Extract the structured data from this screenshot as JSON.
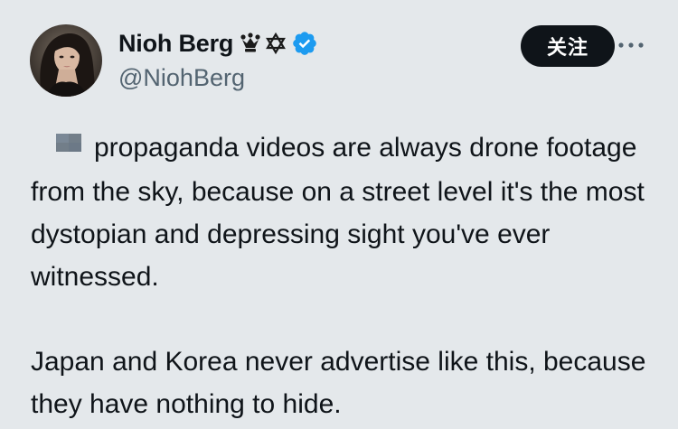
{
  "author": {
    "display_name": "Nioh Berg",
    "handle": "@NiohBerg",
    "name_badges": [
      "crown-icon",
      "star-of-david-icon",
      "verified-badge-icon"
    ]
  },
  "actions": {
    "follow_label": "关注",
    "more_icon": "more-horizontal-icon"
  },
  "tweet": {
    "leading_emoji": "flag-icon",
    "paragraph_1": "propaganda videos are always drone footage from the sky, because on a street level it's the most dystopian and depressing sight you've ever witnessed.",
    "paragraph_2": "Japan and Korea never advertise like this, because they have nothing to hide."
  },
  "colors": {
    "background": "#e4e8eb",
    "text_primary": "#0f1419",
    "text_secondary": "#536471",
    "verified_blue": "#1d9bf0",
    "follow_bg": "#0f1419"
  }
}
